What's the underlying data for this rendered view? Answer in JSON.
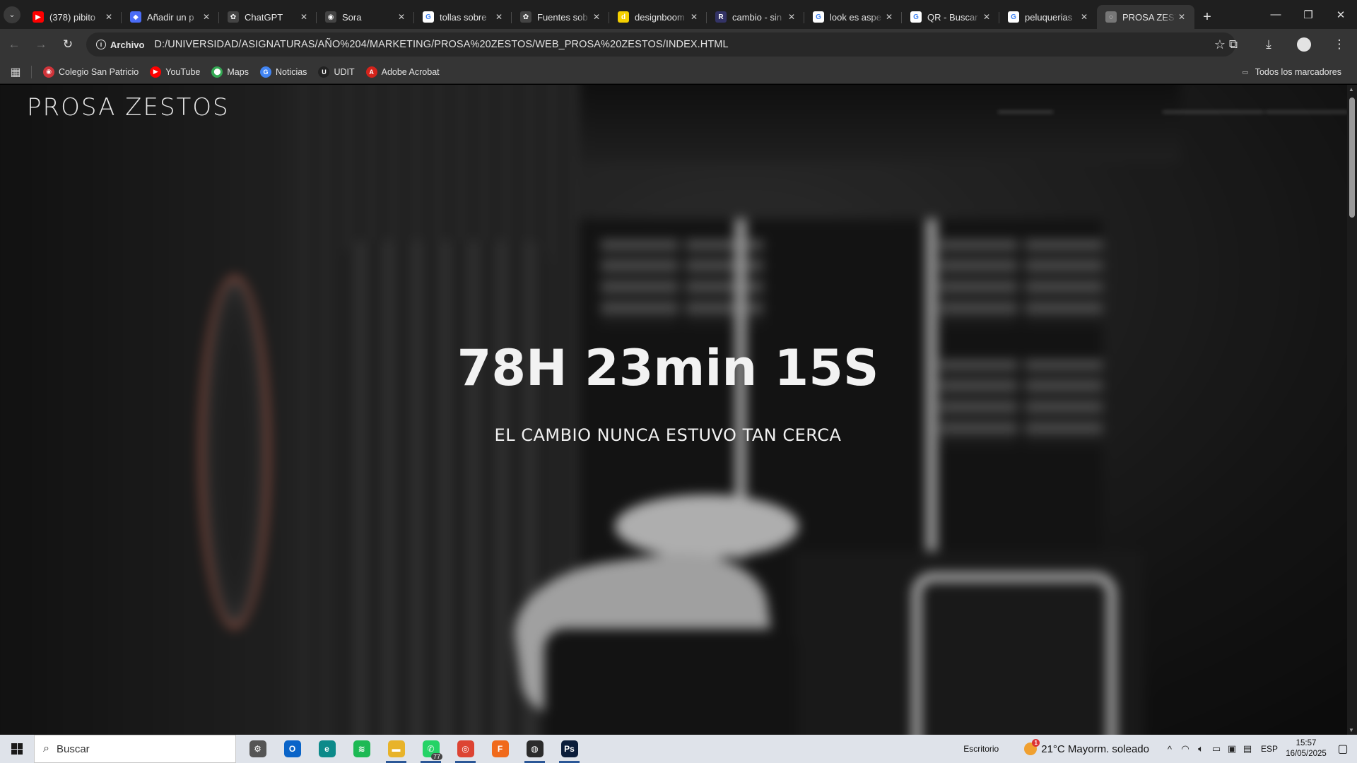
{
  "browser": {
    "tabs": [
      {
        "title": "(378) pibito",
        "icon": "youtube-icon",
        "color": "#ff0000",
        "glyph": "▶"
      },
      {
        "title": "Añadir un p",
        "icon": "shield-icon",
        "color": "#4a6cf7",
        "glyph": "◆"
      },
      {
        "title": "ChatGPT",
        "icon": "openai-icon",
        "color": "#444444",
        "glyph": "✿"
      },
      {
        "title": "Sora",
        "icon": "sora-icon",
        "color": "#444444",
        "glyph": "◉"
      },
      {
        "title": "tollas sobre",
        "icon": "google-icon",
        "color": "#ffffff",
        "glyph": "G"
      },
      {
        "title": "Fuentes sob",
        "icon": "openai-icon",
        "color": "#444444",
        "glyph": "✿"
      },
      {
        "title": "designboom",
        "icon": "designboom-icon",
        "color": "#f5d000",
        "glyph": "d"
      },
      {
        "title": "cambio - sin",
        "icon": "rae-icon",
        "color": "#333366",
        "glyph": "R"
      },
      {
        "title": "look es aspe",
        "icon": "google-icon",
        "color": "#ffffff",
        "glyph": "G"
      },
      {
        "title": "QR - Buscar",
        "icon": "google-icon",
        "color": "#ffffff",
        "glyph": "G"
      },
      {
        "title": "peluquerias",
        "icon": "google-icon",
        "color": "#ffffff",
        "glyph": "G"
      },
      {
        "title": "PROSA ZESTOS",
        "icon": "globe-icon",
        "color": "#777777",
        "glyph": "◌"
      }
    ],
    "close_glyph": "✕",
    "new_tab_glyph": "+",
    "window_controls": {
      "minimize": "—",
      "restore": "❐",
      "close": "✕"
    },
    "nav": {
      "back": "←",
      "forward": "→",
      "reload": "↻"
    },
    "address": {
      "chip_label": "Archivo",
      "url": "D:/UNIVERSIDAD/ASIGNATURAS/AÑO%204/MARKETING/PROSA%20ZESTOS/WEB_PROSA%20ZESTOS/INDEX.HTML",
      "star": "☆"
    },
    "toolbar_icons": {
      "extensions": "⧉",
      "download": "⤓",
      "menu": "⋮"
    },
    "bookmarks": [
      {
        "label": "Colegio San Patricio",
        "color": "#d0343a",
        "glyph": "◉"
      },
      {
        "label": "YouTube",
        "color": "#ff0000",
        "glyph": "▶"
      },
      {
        "label": "Maps",
        "color": "#34a853",
        "glyph": "⬤"
      },
      {
        "label": "Noticias",
        "color": "#4285f4",
        "glyph": "G"
      },
      {
        "label": "UDIT",
        "color": "#222222",
        "glyph": "U"
      },
      {
        "label": "Adobe Acrobat",
        "color": "#d4231b",
        "glyph": "A"
      }
    ],
    "bookmarks_folder": "Todos los marcadores"
  },
  "page": {
    "logo": "PROSA ZESTOS",
    "countdown": "78H 23min 15S",
    "tagline": "EL CAMBIO NUNCA ESTUVO TAN CERCA"
  },
  "taskbar": {
    "search_placeholder": "Buscar",
    "apps": [
      {
        "name": "settings",
        "color": "#555555",
        "glyph": "⚙",
        "running": false
      },
      {
        "name": "outlook",
        "color": "#0a64c8",
        "glyph": "O",
        "running": false
      },
      {
        "name": "edge",
        "color": "#0c8a8a",
        "glyph": "e",
        "running": false
      },
      {
        "name": "spotify",
        "color": "#1db954",
        "glyph": "≋",
        "running": false
      },
      {
        "name": "file-explorer",
        "color": "#e8b32a",
        "glyph": "▬",
        "running": true
      },
      {
        "name": "whatsapp",
        "color": "#25d366",
        "glyph": "✆",
        "running": true,
        "badge": "77"
      },
      {
        "name": "chrome",
        "color": "#dd4433",
        "glyph": "◎",
        "running": true
      },
      {
        "name": "fusion",
        "color": "#f06a1c",
        "glyph": "F",
        "running": false
      },
      {
        "name": "obs",
        "color": "#2b2b2b",
        "glyph": "◍",
        "running": true
      },
      {
        "name": "photoshop",
        "color": "#0b1d3a",
        "glyph": "Ps",
        "running": true
      }
    ],
    "desktop_label": "Escritorio",
    "weather": {
      "temp": "21°C",
      "desc": "Mayorm. soleado",
      "alert": "1"
    },
    "language": "ESP",
    "time": "15:57",
    "date": "16/05/2025"
  }
}
